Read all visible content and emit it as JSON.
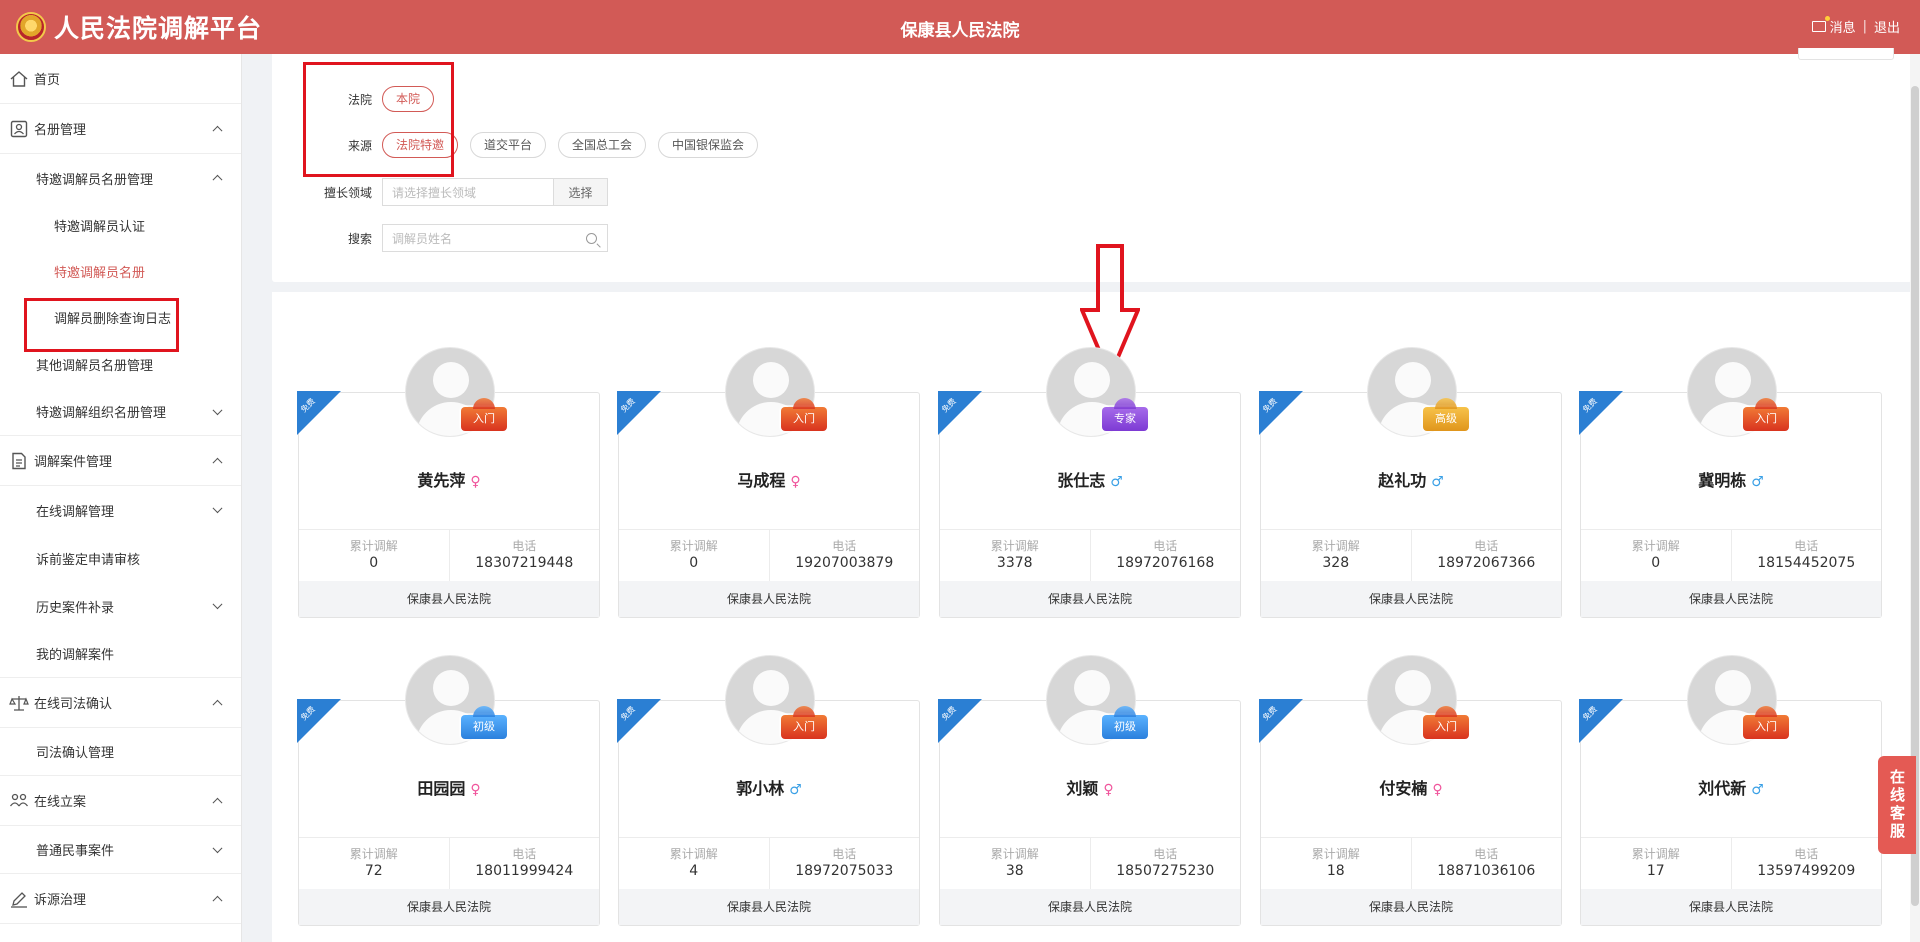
{
  "header": {
    "brand": "人民法院调解平台",
    "court": "保康县人民法院",
    "messages": "消息",
    "logout": "退出"
  },
  "sidebar": {
    "home": "首页",
    "roster": "名册管理",
    "invited_roster_mgmt": "特邀调解员名册管理",
    "invited_cert": "特邀调解员认证",
    "invited_roster": "特邀调解员名册",
    "delete_log": "调解员删除查询日志",
    "other_roster": "其他调解员名册管理",
    "org_roster": "特邀调解组织名册管理",
    "case_mgmt": "调解案件管理",
    "online_mgmt": "在线调解管理",
    "pre_appraisal": "诉前鉴定申请审核",
    "history_supplement": "历史案件补录",
    "my_cases": "我的调解案件",
    "judicial_confirm": "在线司法确认",
    "judicial_confirm_mgmt": "司法确认管理",
    "online_filing": "在线立案",
    "civil_cases": "普通民事案件",
    "source_governance": "诉源治理"
  },
  "filters": {
    "court_label": "法院",
    "court_option": "本院",
    "source_label": "来源",
    "source_options": [
      "法院特邀",
      "道交平台",
      "全国总工会",
      "中国银保监会"
    ],
    "field_label": "擅长领域",
    "field_placeholder": "请选择擅长领域",
    "choose_button": "选择",
    "search_label": "搜索",
    "search_placeholder": "调解员姓名"
  },
  "card_labels": {
    "ribbon": "免费",
    "total_label": "累计调解",
    "phone_label": "电话"
  },
  "mediators": [
    {
      "name": "黄先萍",
      "gender": "♀",
      "level": "入门",
      "total": "0",
      "phone": "18307219448",
      "court": "保康县人民法院"
    },
    {
      "name": "马成程",
      "gender": "♀",
      "level": "入门",
      "total": "0",
      "phone": "19207003879",
      "court": "保康县人民法院"
    },
    {
      "name": "张仕志",
      "gender": "♂",
      "level": "专家",
      "total": "3378",
      "phone": "18972076168",
      "court": "保康县人民法院"
    },
    {
      "name": "赵礼功",
      "gender": "♂",
      "level": "高级",
      "total": "328",
      "phone": "18972067366",
      "court": "保康县人民法院"
    },
    {
      "name": "冀明栋",
      "gender": "♂",
      "level": "入门",
      "total": "0",
      "phone": "18154452075",
      "court": "保康县人民法院"
    },
    {
      "name": "田园园",
      "gender": "♀",
      "level": "初级",
      "total": "72",
      "phone": "18011999424",
      "court": "保康县人民法院"
    },
    {
      "name": "郭小林",
      "gender": "♂",
      "level": "入门",
      "total": "4",
      "phone": "18972075033",
      "court": "保康县人民法院"
    },
    {
      "name": "刘颖",
      "gender": "♀",
      "level": "初级",
      "total": "38",
      "phone": "18507275230",
      "court": "保康县人民法院"
    },
    {
      "name": "付安楠",
      "gender": "♀",
      "level": "入门",
      "total": "18",
      "phone": "18871036106",
      "court": "保康县人民法院"
    },
    {
      "name": "刘代新",
      "gender": "♂",
      "level": "入门",
      "total": "17",
      "phone": "13597499209",
      "court": "保康县人民法院"
    }
  ],
  "widget": {
    "online_service": "在线客服"
  }
}
